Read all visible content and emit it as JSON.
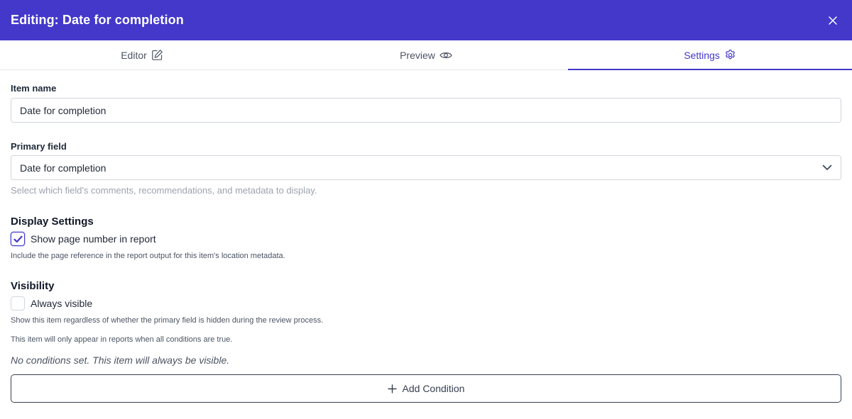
{
  "header": {
    "title": "Editing: Date for completion",
    "close_icon": "close-icon"
  },
  "tabs": [
    {
      "label": "Editor",
      "icon": "edit-icon",
      "active": false
    },
    {
      "label": "Preview",
      "icon": "eye-icon",
      "active": false
    },
    {
      "label": "Settings",
      "icon": "gear-icon",
      "active": true
    }
  ],
  "item_name": {
    "label": "Item name",
    "value": "Date for completion"
  },
  "primary_field": {
    "label": "Primary field",
    "selected": "Date for completion",
    "helper": "Select which field's comments, recommendations, and metadata to display."
  },
  "display_settings": {
    "title": "Display Settings",
    "show_page_number": {
      "label": "Show page number in report",
      "checked": true
    },
    "note": "Include the page reference in the report output for this item's location metadata."
  },
  "visibility": {
    "title": "Visibility",
    "always_visible": {
      "label": "Always visible",
      "checked": false
    },
    "note": "Show this item regardless of whether the primary field is hidden during the review process.",
    "conditions_note": "This item will only appear in reports when all conditions are true.",
    "empty_state": "No conditions set. This item will always be visible.",
    "add_button": "Add Condition"
  },
  "colors": {
    "primary": "#4338ca",
    "border": "#d1d5db"
  }
}
